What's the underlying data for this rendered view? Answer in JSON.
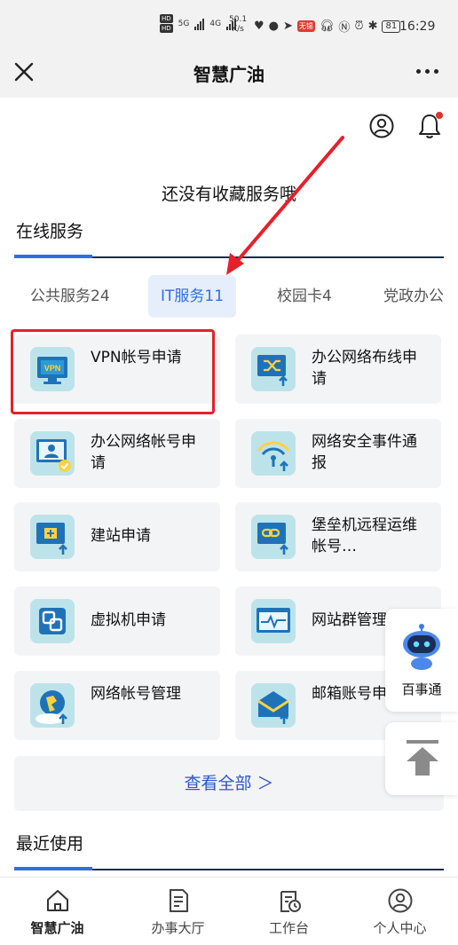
{
  "status_bar": {
    "net_speed": "50.1",
    "net_unit": "K/s",
    "battery": "81",
    "time": "16:29",
    "hd1": "HD",
    "hd2": "HD",
    "sig1": "5G",
    "sig2": "4G",
    "red_badge": "无锡"
  },
  "titlebar": {
    "title": "智慧广油"
  },
  "favorites": {
    "empty_text": "还没有收藏服务哦"
  },
  "online_services": {
    "title": "在线服务",
    "tabs": [
      {
        "label": "公共服务24"
      },
      {
        "label": "IT服务11"
      },
      {
        "label": "校园卡4"
      },
      {
        "label": "党政办公"
      }
    ],
    "items": [
      {
        "label": "VPN帐号申请",
        "icon": "vpn-monitor-icon"
      },
      {
        "label": "办公网络布线申请",
        "icon": "network-wiring-icon"
      },
      {
        "label": "办公网络帐号申请",
        "icon": "network-account-icon"
      },
      {
        "label": "网络安全事件通报",
        "icon": "wifi-security-icon"
      },
      {
        "label": "建站申请",
        "icon": "site-build-icon"
      },
      {
        "label": "堡垒机远程运维帐号…",
        "icon": "bastion-link-icon"
      },
      {
        "label": "虚拟机申请",
        "icon": "vm-icon"
      },
      {
        "label": "网站群管理",
        "icon": "site-group-icon"
      },
      {
        "label": "网络帐号管理",
        "icon": "globe-account-icon"
      },
      {
        "label": "邮箱账号申请",
        "icon": "mailbox-icon"
      }
    ],
    "view_all": "查看全部 ＞"
  },
  "recent": {
    "title": "最近使用"
  },
  "floating": {
    "bot_label": "百事通"
  },
  "bottom_nav": [
    {
      "label": "智慧广油",
      "icon": "home-icon"
    },
    {
      "label": "办事大厅",
      "icon": "document-icon"
    },
    {
      "label": "工作台",
      "icon": "clipboard-clock-icon"
    },
    {
      "label": "个人中心",
      "icon": "user-icon"
    }
  ],
  "colors": {
    "accent": "#2f6fe0",
    "highlight_red": "#e5202a",
    "icon_bg": "#bde3ea"
  }
}
